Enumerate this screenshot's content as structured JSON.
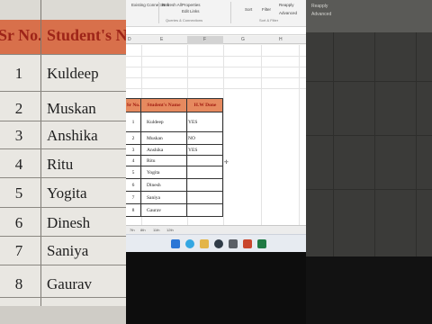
{
  "zoom": {
    "header": {
      "sr": "Sr No.",
      "name": "Student's Na"
    },
    "rows": [
      {
        "sr": "1",
        "name": "Kuldeep"
      },
      {
        "sr": "2",
        "name": "Muskan"
      },
      {
        "sr": "3",
        "name": "Anshika"
      },
      {
        "sr": "4",
        "name": "Ritu"
      },
      {
        "sr": "5",
        "name": "Yogita"
      },
      {
        "sr": "6",
        "name": "Dinesh"
      },
      {
        "sr": "7",
        "name": "Saniya"
      },
      {
        "sr": "8",
        "name": "Gaurav"
      }
    ]
  },
  "ribbon": {
    "existing_connections": "Existing Connections",
    "refresh_all": "Refresh All",
    "properties": "Properties",
    "edit_links": "Edit Links",
    "group_queries": "Queries & Connections",
    "sort": "Sort",
    "filter": "Filter",
    "reapply": "Reapply",
    "advanced": "Advanced",
    "group_sort": "Sort & Filter"
  },
  "columns": [
    "D",
    "E",
    "F",
    "G",
    "H"
  ],
  "table": {
    "headers": {
      "sr": "Sr No.",
      "name": "Student's Name",
      "hw": "H.W Done"
    },
    "rows": [
      {
        "sr": "1",
        "name": "Kuldeep",
        "hw": "YES"
      },
      {
        "sr": "2",
        "name": "Muskan",
        "hw": "NO"
      },
      {
        "sr": "3",
        "name": "Anshika",
        "hw": "YES"
      },
      {
        "sr": "4",
        "name": "Ritu",
        "hw": ""
      },
      {
        "sr": "5",
        "name": "Yogita",
        "hw": ""
      },
      {
        "sr": "6",
        "name": "Dinesh",
        "hw": ""
      },
      {
        "sr": "7",
        "name": "Saniya",
        "hw": ""
      },
      {
        "sr": "8",
        "name": "Gaurav",
        "hw": ""
      }
    ]
  },
  "sheet_tabs": [
    "7th",
    "8th",
    "11th",
    "12th"
  ],
  "right": {
    "reapply": "Reapply",
    "advanced": "Advanced"
  },
  "colors": {
    "header_fill": "#e68a5f",
    "header_text": "#a11b10"
  }
}
